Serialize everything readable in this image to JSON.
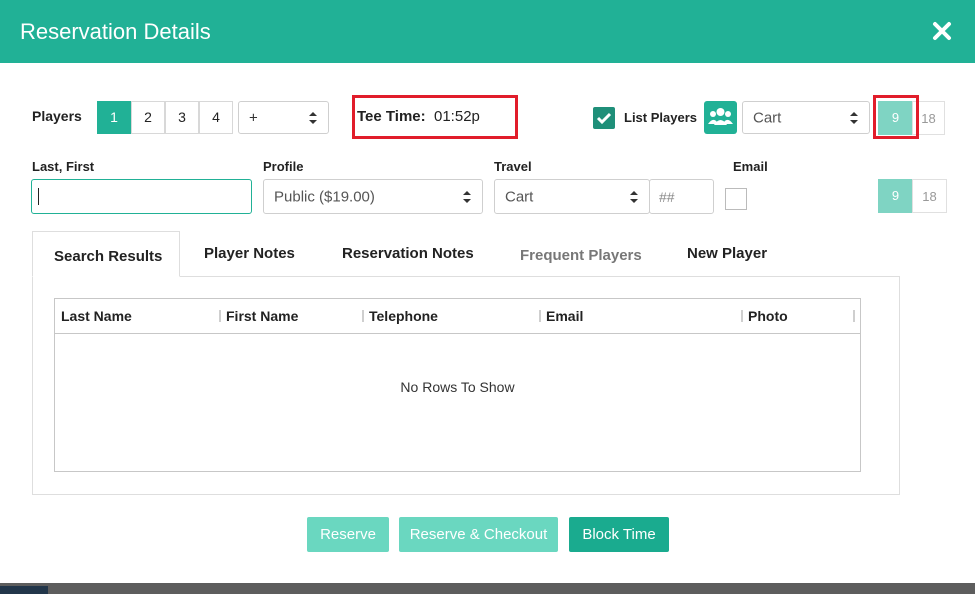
{
  "modal": {
    "title": "Reservation Details",
    "close_icon": "close-icon"
  },
  "players": {
    "label": "Players",
    "buttons": [
      "1",
      "2",
      "3",
      "4"
    ],
    "active": "1",
    "more_select": "+"
  },
  "tee_time": {
    "label": "Tee Time:",
    "value": "01:52p"
  },
  "list_players": {
    "label": "List Players",
    "checked": true,
    "travel_select": "Cart",
    "holes": [
      "9",
      "18"
    ],
    "active_hole": "9"
  },
  "form": {
    "last_first_label": "Last, First",
    "last_first_value": "",
    "profile_label": "Profile",
    "profile_value": "Public ($19.00)",
    "travel_label": "Travel",
    "travel_value": "Cart",
    "travel_number_placeholder": "##",
    "email_label": "Email",
    "holes": [
      "9",
      "18"
    ],
    "active_hole": "9"
  },
  "tabs": [
    "Search Results",
    "Player Notes",
    "Reservation Notes",
    "Frequent Players",
    "New Player"
  ],
  "active_tab": "Search Results",
  "grid": {
    "columns": [
      "Last Name",
      "First Name",
      "Telephone",
      "Email",
      "Photo"
    ],
    "empty_message": "No Rows To Show"
  },
  "actions": {
    "reserve": "Reserve",
    "reserve_checkout": "Reserve & Checkout",
    "block_time": "Block Time"
  },
  "colors": {
    "accent": "#21b196",
    "highlight": "#e11d2a",
    "muted_accent": "#7fd4c3"
  }
}
